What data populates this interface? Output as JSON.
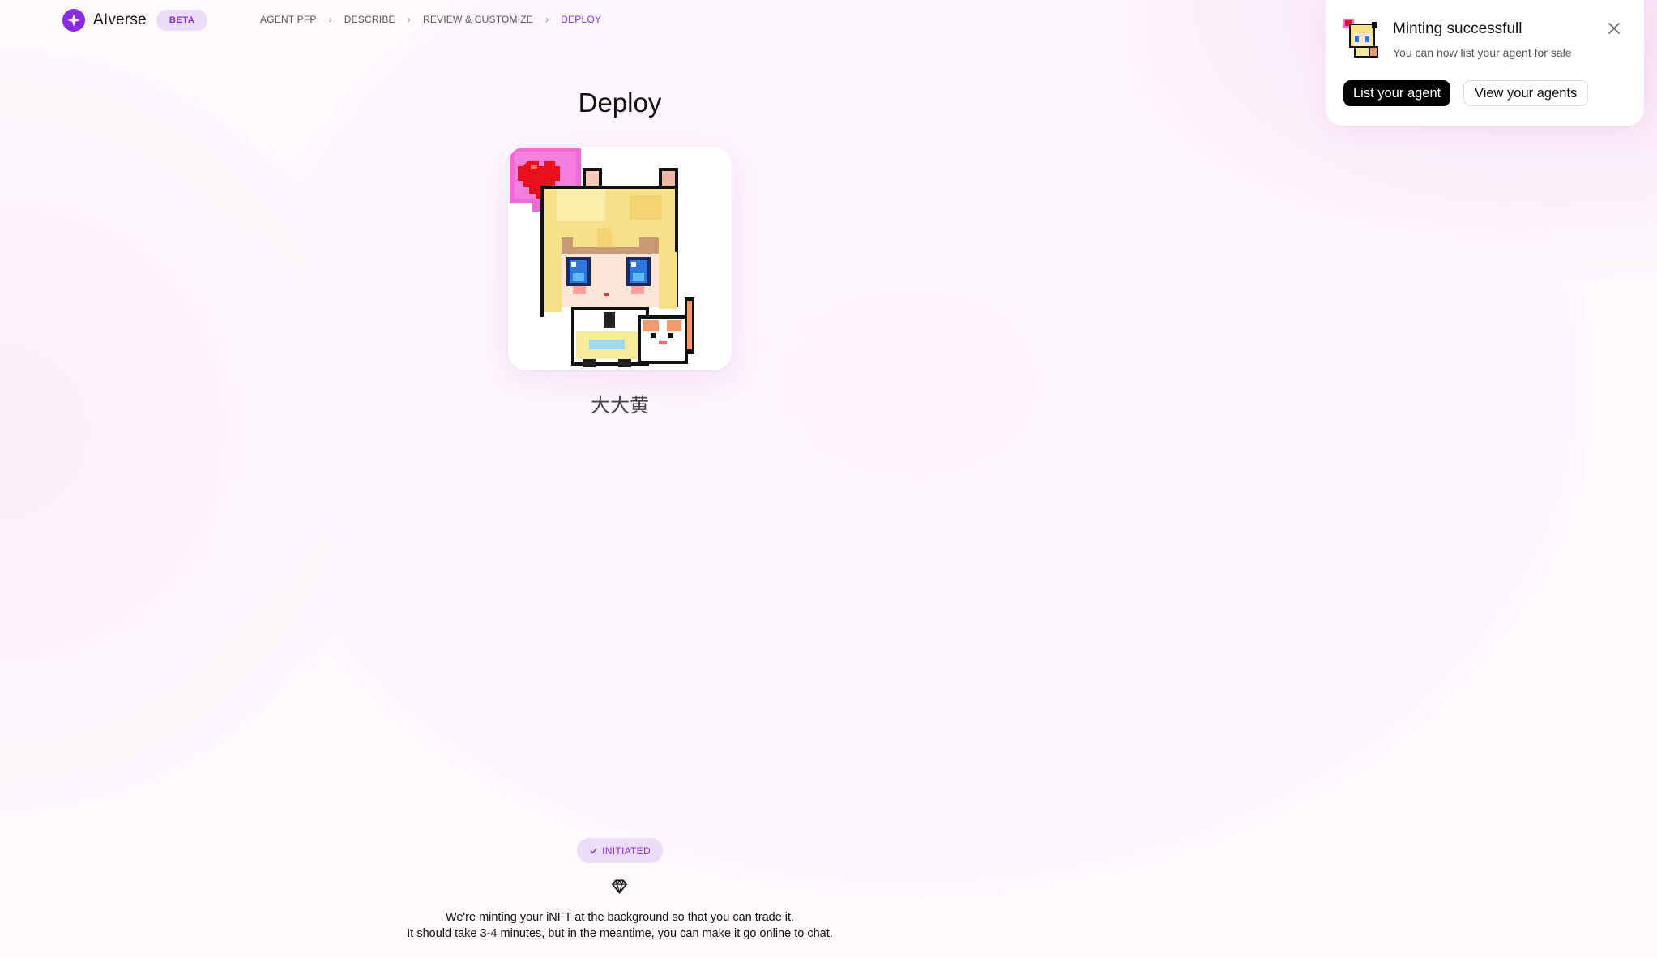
{
  "brand": {
    "name": "AIverse",
    "badge": "BETA",
    "accent_color": "#8a2be2",
    "logo_icon": "sparkle-icon"
  },
  "breadcrumb": {
    "steps": [
      {
        "label": "AGENT PFP",
        "active": false
      },
      {
        "label": "DESCRIBE",
        "active": false
      },
      {
        "label": "REVIEW & CUSTOMIZE",
        "active": false
      },
      {
        "label": "DEPLOY",
        "active": true
      }
    ],
    "separator_icon": "chevron-right-icon"
  },
  "main": {
    "title": "Deploy",
    "agent_name": "大大黄",
    "agent_image": "pixel-art anime girl with blonde hair, cat ears, heart balloon and small cat"
  },
  "status": {
    "label": "INITIATED",
    "icon": "check-icon",
    "info_icon": "diamond-icon",
    "message_line1": "We're minting your iNFT at the background so that you can trade it.",
    "message_line2": "It should take 3-4 minutes, but in the meantime, you can make it go online to chat."
  },
  "toast": {
    "title": "Minting successfull",
    "message": "You can now list your agent for sale",
    "primary_button": "List your agent",
    "secondary_button": "View your agents",
    "close_icon": "close-icon"
  }
}
